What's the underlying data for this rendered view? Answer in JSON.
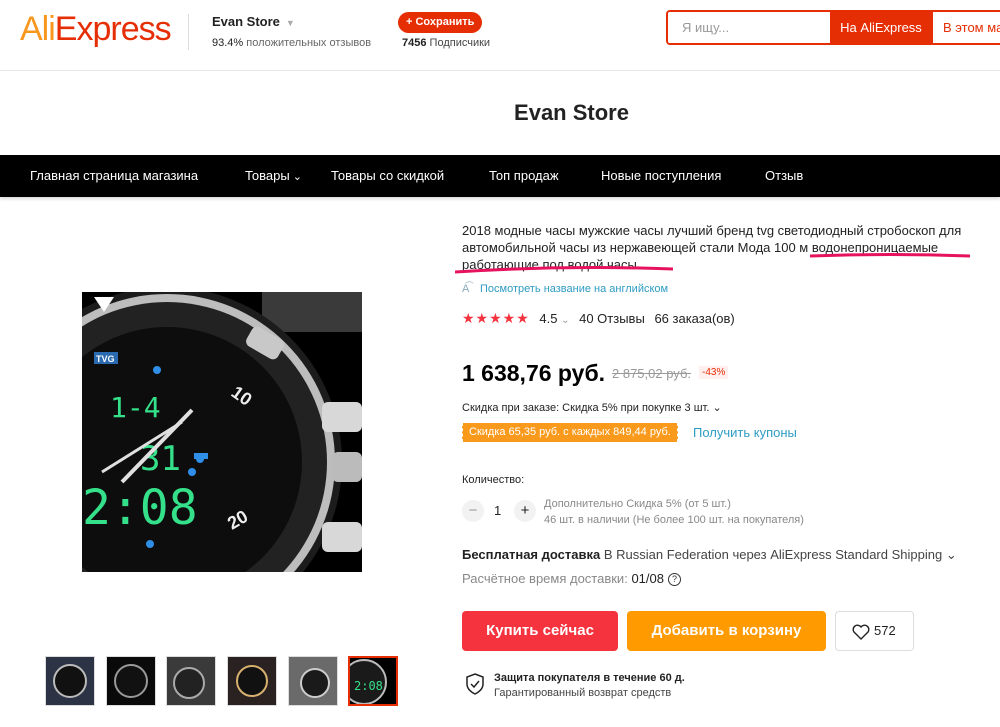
{
  "header": {
    "logo": "AliExpress",
    "store_name": "Evan Store",
    "rating_value": "93.4%",
    "rating_label": "положительных отзывов",
    "follow_label": "+ Сохранить",
    "subscribers_count": "7456",
    "subscribers_label": "Подписчики",
    "search_placeholder": "Я ищу...",
    "search_ali_label": "На AliExpress",
    "search_store_label": "В этом ма"
  },
  "store_title": "Evan Store",
  "nav": {
    "items": [
      {
        "label": "Главная страница магазина"
      },
      {
        "label": "Товары",
        "has_dropdown": true
      },
      {
        "label": "Товары со скидкой"
      },
      {
        "label": "Топ продаж"
      },
      {
        "label": "Новые поступления"
      },
      {
        "label": "Отзыв"
      }
    ]
  },
  "product": {
    "title": "2018 модные часы мужские часы лучший бренд tvg светодиодный стробоскоп для автомобильной часы из нержавеющей стали Мода 100 м водонепроницаемые работающие под водой часы",
    "translate_label": "Посмотреть название на английском",
    "rating": "4.5",
    "stars": 4.5,
    "reviews": "40 Отзывы",
    "orders": "66 заказа(ов)",
    "price": "1 638,76 руб.",
    "old_price": "2 875,02 руб.",
    "discount": "-43%",
    "order_discount": "Скидка при заказе: Скидка 5% при покупке 3 шт.",
    "coupon_tag": "Скидка 65,35 руб. с каждых 849,44 руб.",
    "get_coupons": "Получить купоны",
    "quantity_label": "Количество:",
    "quantity_value": "1",
    "quantity_extra": "Дополнительно Скидка 5% (от 5 шт.)",
    "quantity_stock": "46 шт. в наличии (Не более 100 шт. на покупателя)",
    "shipping_bold": "Бесплатная доставка",
    "shipping_rest": "В Russian Federation через AliExpress Standard Shipping",
    "delivery_label": "Расчётное время доставки:",
    "delivery_value": "01/08",
    "buy_now": "Купить сейчас",
    "add_cart": "Добавить в корзину",
    "wishlist_count": "572",
    "protection_title": "Защита покупателя в течение 60 д.",
    "protection_sub": "Гарантированный возврат средств",
    "image_brand": "TVG",
    "image_time": "2:08",
    "image_date": "1-4",
    "image_small": "31"
  },
  "colors": {
    "accent": "#e62e04",
    "orange": "#ff9a00",
    "buy_red": "#f5333f",
    "link_blue": "#2e9cc3"
  }
}
